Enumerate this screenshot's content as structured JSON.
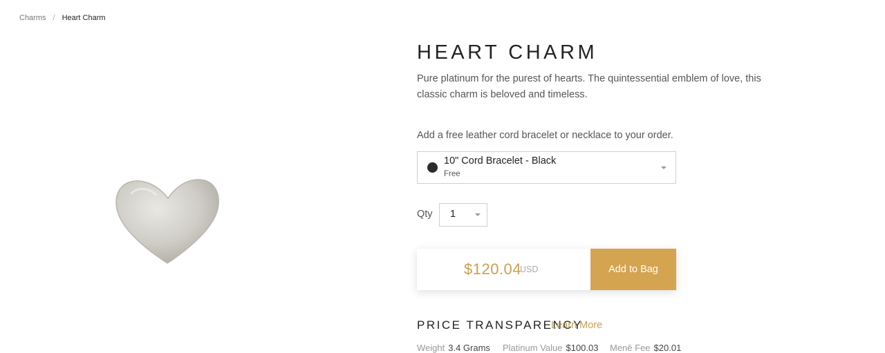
{
  "breadcrumb": {
    "parent": "Charms",
    "separator": "/",
    "current": "Heart Charm"
  },
  "product": {
    "image_icon": "heart-charm-image",
    "title": "HEART CHARM",
    "description": "Pure platinum for the purest of hearts. The quintessential emblem of love, this classic charm is beloved and timeless."
  },
  "addon": {
    "label": "Add a free leather cord bracelet or necklace to your order.",
    "selected": {
      "name": "10\" Cord Bracelet - Black",
      "price": "Free",
      "swatch_color": "#2b2b2b"
    }
  },
  "quantity": {
    "label": "Qty",
    "value": "1"
  },
  "purchase": {
    "price": "$120.04",
    "currency": "USD",
    "add_to_bag_label": "Add to Bag",
    "price_color": "#c9a04e",
    "button_color": "#d4a450"
  },
  "price_transparency": {
    "heading": "PRICE TRANSPARENCY",
    "learn_more": "Learn More",
    "items": [
      {
        "label": "Weight",
        "value": "3.4 Grams"
      },
      {
        "label": "Platinum Value",
        "value": "$100.03"
      },
      {
        "label": "Menē Fee",
        "value": "$20.01"
      }
    ]
  }
}
